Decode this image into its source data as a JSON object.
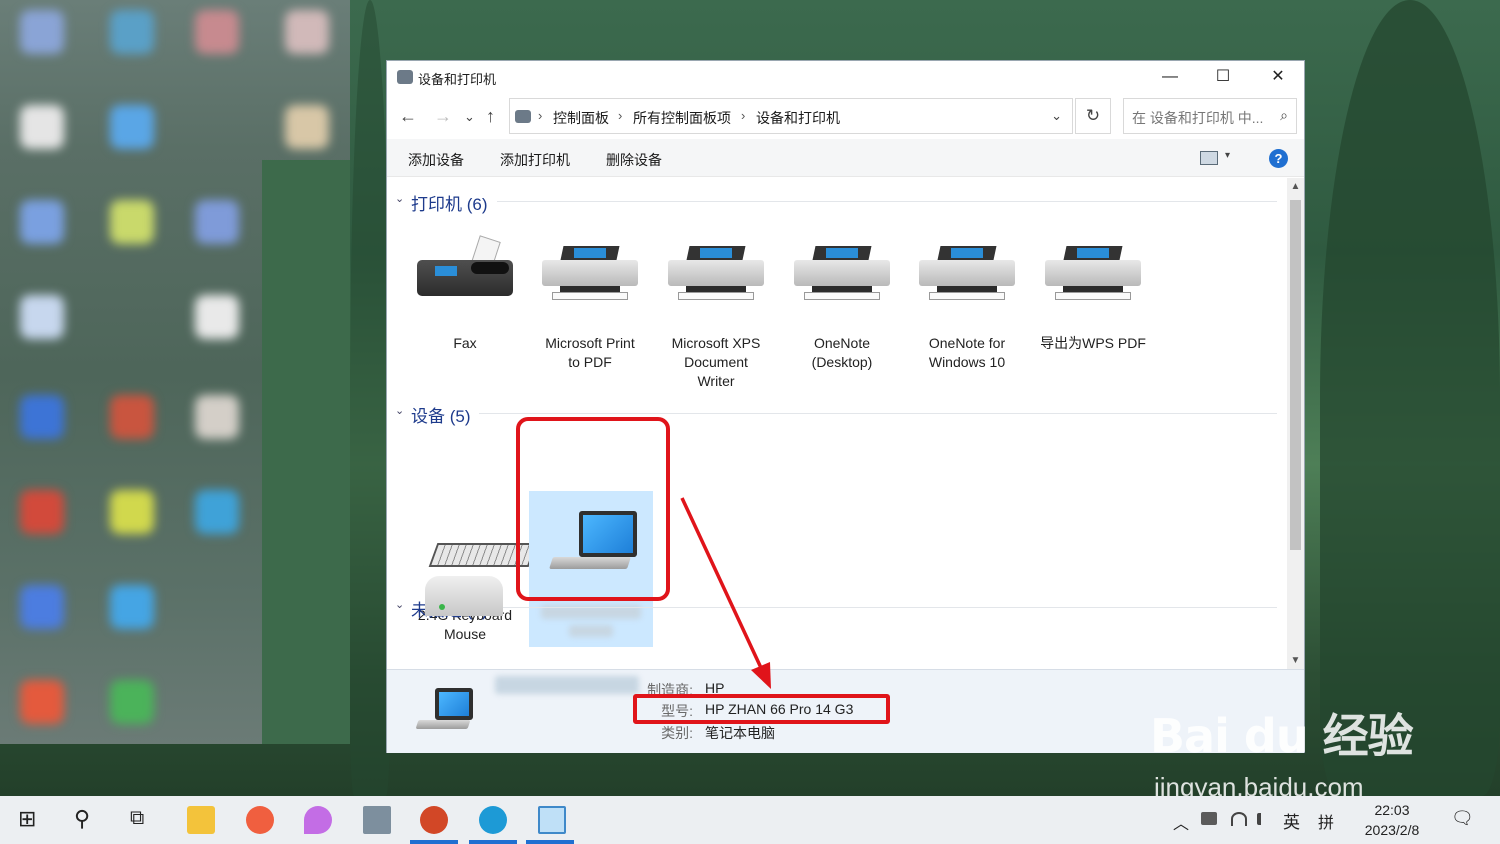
{
  "window": {
    "title": "设备和打印机",
    "minimize": "—",
    "maximize": "☐",
    "close": "✕"
  },
  "nav": {
    "back": "←",
    "forward": "→",
    "recent": "⌄",
    "up": "↑",
    "breadcrumb": [
      "控制面板",
      "所有控制面板项",
      "设备和打印机"
    ],
    "separator": "›",
    "dropdown": "⌄",
    "refresh": "↻"
  },
  "search": {
    "placeholder": "在 设备和打印机 中...",
    "icon": "⌕"
  },
  "toolbar": {
    "add_device": "添加设备",
    "add_printer": "添加打印机",
    "remove_device": "删除设备",
    "view_dropdown": "▾",
    "help": "?"
  },
  "groups": {
    "printers": {
      "title": "打印机 (6)"
    },
    "devices": {
      "title": "设备 (5)"
    },
    "unspecified": {
      "title": "未指定 (1)"
    },
    "chevron": "⌄"
  },
  "printers": [
    {
      "line1": "Fax",
      "line2": "",
      "line3": ""
    },
    {
      "line1": "Microsoft Print",
      "line2": "to PDF",
      "line3": ""
    },
    {
      "line1": "Microsoft XPS",
      "line2": "Document",
      "line3": "Writer"
    },
    {
      "line1": "OneNote",
      "line2": "(Desktop)",
      "line3": ""
    },
    {
      "line1": "OneNote for",
      "line2": "Windows 10",
      "line3": ""
    },
    {
      "line1": "导出为WPS PDF",
      "line2": "",
      "line3": ""
    }
  ],
  "devices": [
    {
      "line1": "2.4G Keyboard",
      "line2": "Mouse"
    }
  ],
  "details": {
    "manufacturer_label": "制造商:",
    "manufacturer_value": "HP",
    "model_label": "型号:",
    "model_value": "HP ZHAN 66 Pro 14 G3",
    "category_label": "类别:",
    "category_value": "笔记本电脑"
  },
  "scrollbar": {
    "up": "▲",
    "down": "▼"
  },
  "taskbar": {
    "start": "⊞",
    "search": "⚲",
    "taskview": "⧉",
    "tray_up": "︿",
    "ime_lang": "英",
    "ime_mode": "拼",
    "time": "22:03",
    "date": "2023/2/8",
    "notification": "🗨"
  },
  "watermark": {
    "brand": "Bai du 经验",
    "url": "jingyan.baidu.com"
  },
  "colors": {
    "accent": "#1f6fd1",
    "highlight_red": "#e0141a",
    "group_title": "#1e3b8c",
    "selection": "#cce8ff"
  }
}
